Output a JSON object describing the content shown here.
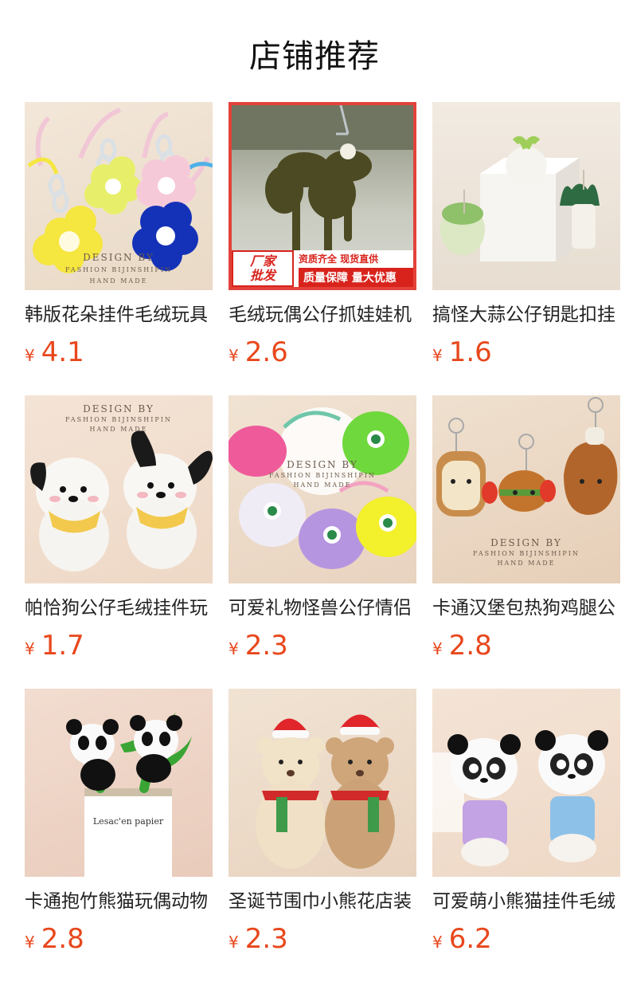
{
  "page": {
    "title": "店铺推荐"
  },
  "products": [
    {
      "name": "韩版花朵挂件毛绒玩具",
      "currency": "¥",
      "price": "4.1",
      "watermark": [
        "DESIGN BY",
        "FASHION BIJINSHIPIN",
        "HAND MADE"
      ]
    },
    {
      "name": "毛绒玩偶公仔抓娃娃机",
      "currency": "¥",
      "price": "2.6",
      "promo": {
        "badge_line1": "厂家",
        "badge_line2": "批发",
        "top": "资质齐全 现货直供",
        "bottom": "质量保障 量大优惠"
      }
    },
    {
      "name": "搞怪大蒜公仔钥匙扣挂",
      "currency": "¥",
      "price": "1.6"
    },
    {
      "name": "帕恰狗公仔毛绒挂件玩",
      "currency": "¥",
      "price": "1.7",
      "watermark": [
        "DESIGN BY",
        "FASHION BIJINSHIPIN",
        "HAND MADE"
      ]
    },
    {
      "name": "可爱礼物怪兽公仔情侣",
      "currency": "¥",
      "price": "2.3",
      "watermark": [
        "DESIGN BY",
        "FASHION BIJINSHIPIN",
        "HAND MADE"
      ]
    },
    {
      "name": "卡通汉堡包热狗鸡腿公",
      "currency": "¥",
      "price": "2.8",
      "watermark": [
        "DESIGN BY",
        "FASHION BIJINSHIPIN",
        "HAND MADE"
      ]
    },
    {
      "name": "卡通抱竹熊猫玩偶动物",
      "currency": "¥",
      "price": "2.8",
      "sign": [
        "Lesac'en papier"
      ]
    },
    {
      "name": "圣诞节围巾小熊花店装",
      "currency": "¥",
      "price": "2.3"
    },
    {
      "name": "可爱萌小熊猫挂件毛绒",
      "currency": "¥",
      "price": "6.2"
    }
  ]
}
